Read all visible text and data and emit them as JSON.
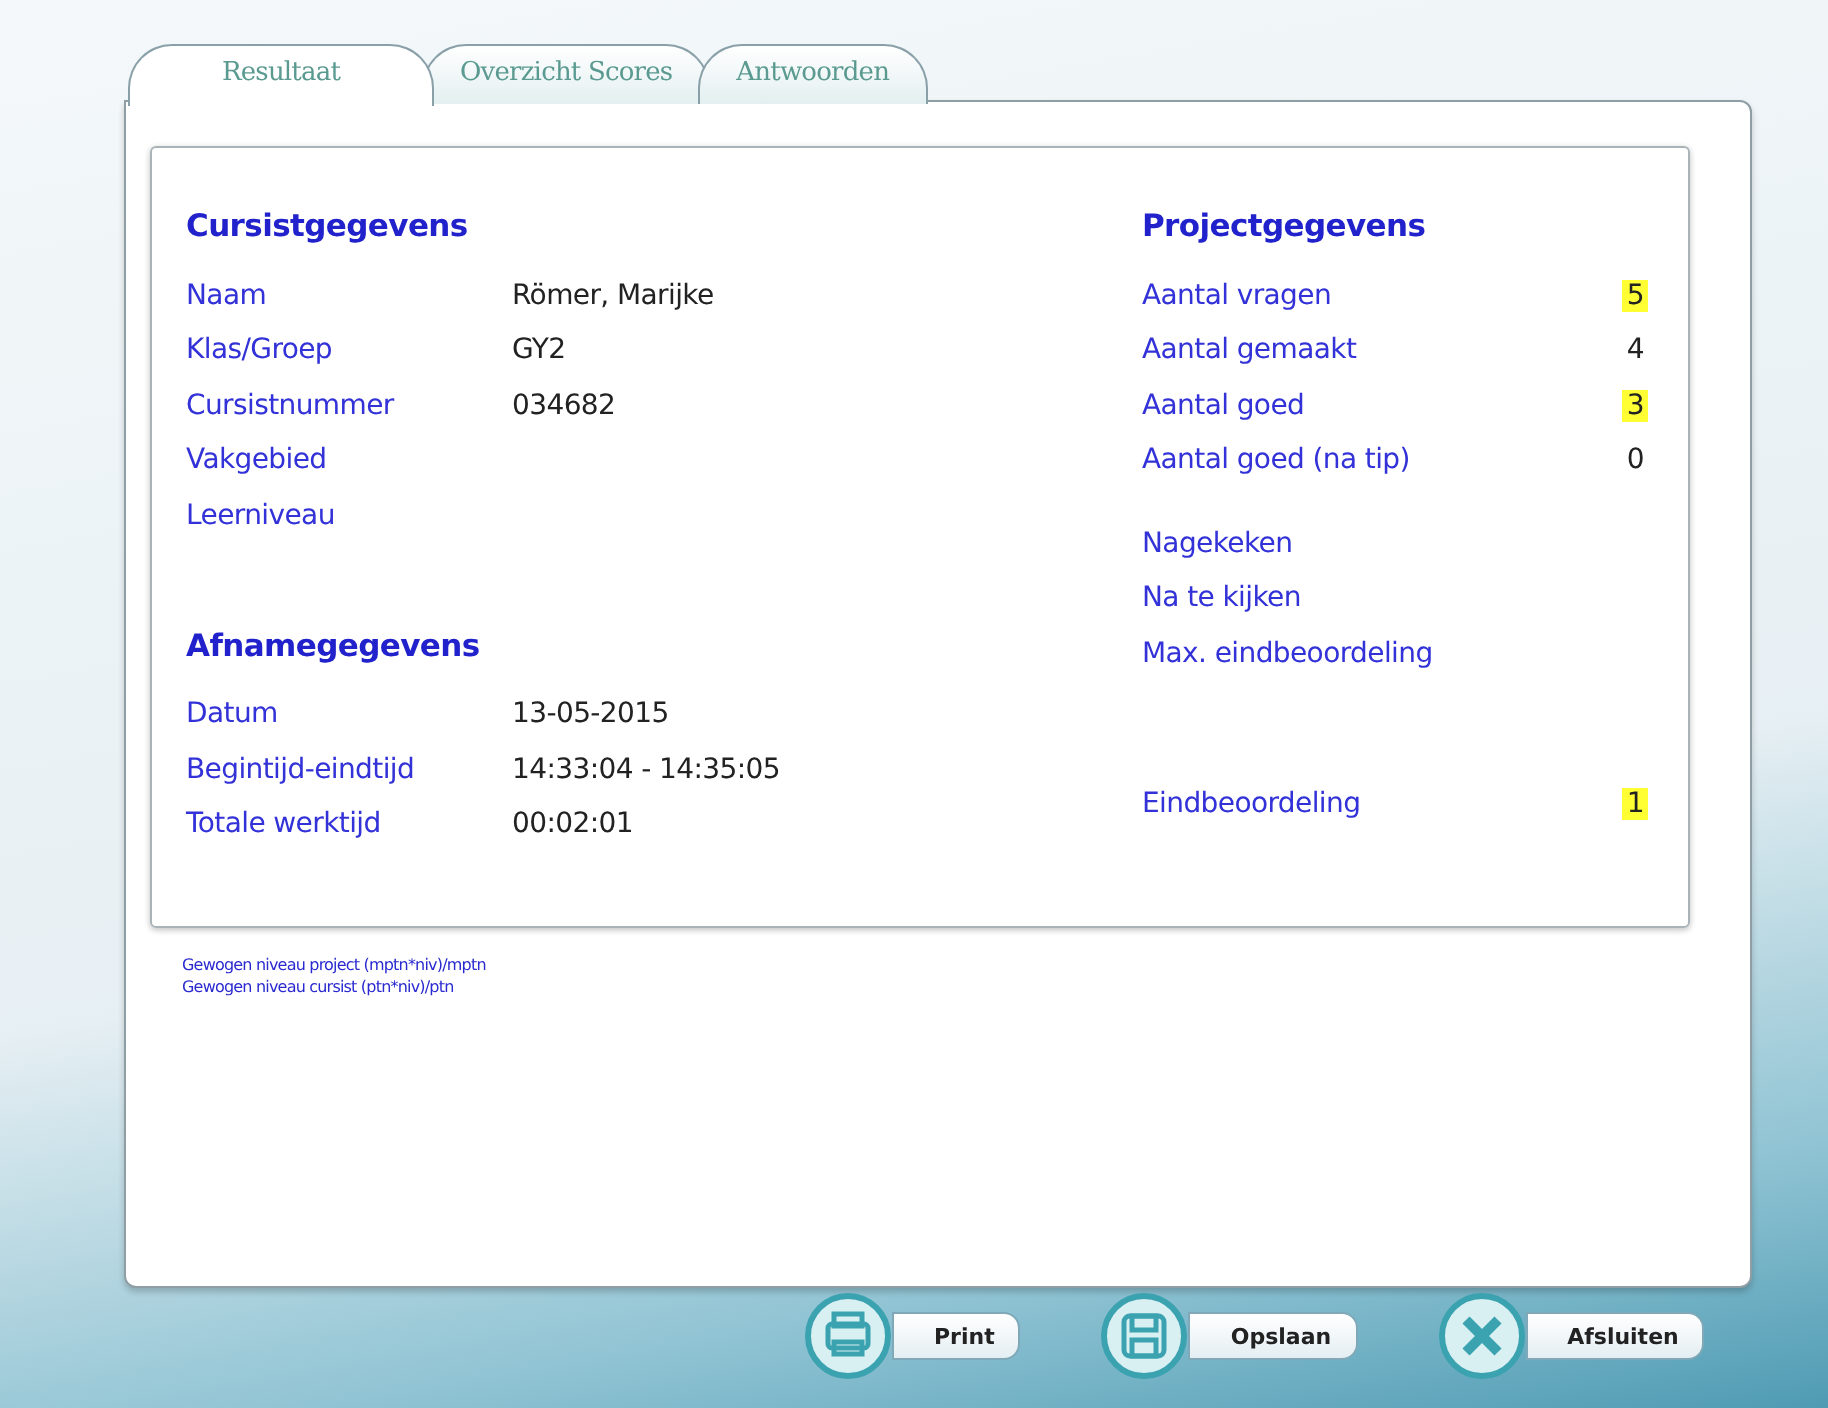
{
  "tabs": [
    {
      "label": "Resultaat",
      "selected": true
    },
    {
      "label": "Overzicht Scores",
      "selected": false
    },
    {
      "label": "Antwoorden",
      "selected": false
    }
  ],
  "student_section": {
    "heading": "Cursistgegevens",
    "rows": [
      {
        "label": "Naam",
        "value": "Römer, Marijke"
      },
      {
        "label": "Klas/Groep",
        "value": "GY2"
      },
      {
        "label": "Cursistnummer",
        "value": "034682"
      },
      {
        "label": "Vakgebied"
      },
      {
        "label": "Leerniveau"
      }
    ]
  },
  "test_section": {
    "heading": "Afnamegegevens",
    "rows": [
      {
        "label": "Datum",
        "value": "13-05-2015"
      },
      {
        "label": "Begintijd-eindtijd",
        "value": "14:33:04 - 14:35:05"
      },
      {
        "label": "Totale werktijd",
        "value": "00:02:01"
      }
    ]
  },
  "project_section": {
    "heading": "Projectgegevens",
    "groups": [
      [
        {
          "label": "Aantal vragen",
          "value": "5",
          "highlighted": true
        },
        {
          "label": "Aantal gemaakt",
          "value": "4",
          "highlighted": false
        },
        {
          "label": "Aantal goed",
          "value": "3",
          "highlighted": true
        },
        {
          "label": "Aantal goed (na tip)",
          "value": "0",
          "highlighted": false
        }
      ],
      [
        {
          "label": "Nagekeken"
        },
        {
          "label": "Na te kijken"
        },
        {
          "label": "Max. eindbeoordeling"
        }
      ],
      [
        {
          "label": "Eindbeoordeling",
          "value": "1",
          "highlighted": true
        }
      ]
    ]
  },
  "notes": [
    "Gewogen niveau project (mptn*niv)/mptn",
    "Gewogen niveau cursist (ptn*niv)/ptn"
  ],
  "buttons": [
    {
      "kind": "print",
      "label": "Print"
    },
    {
      "kind": "save",
      "label": "Opslaan"
    },
    {
      "kind": "close",
      "label": "Afsluiten"
    }
  ]
}
